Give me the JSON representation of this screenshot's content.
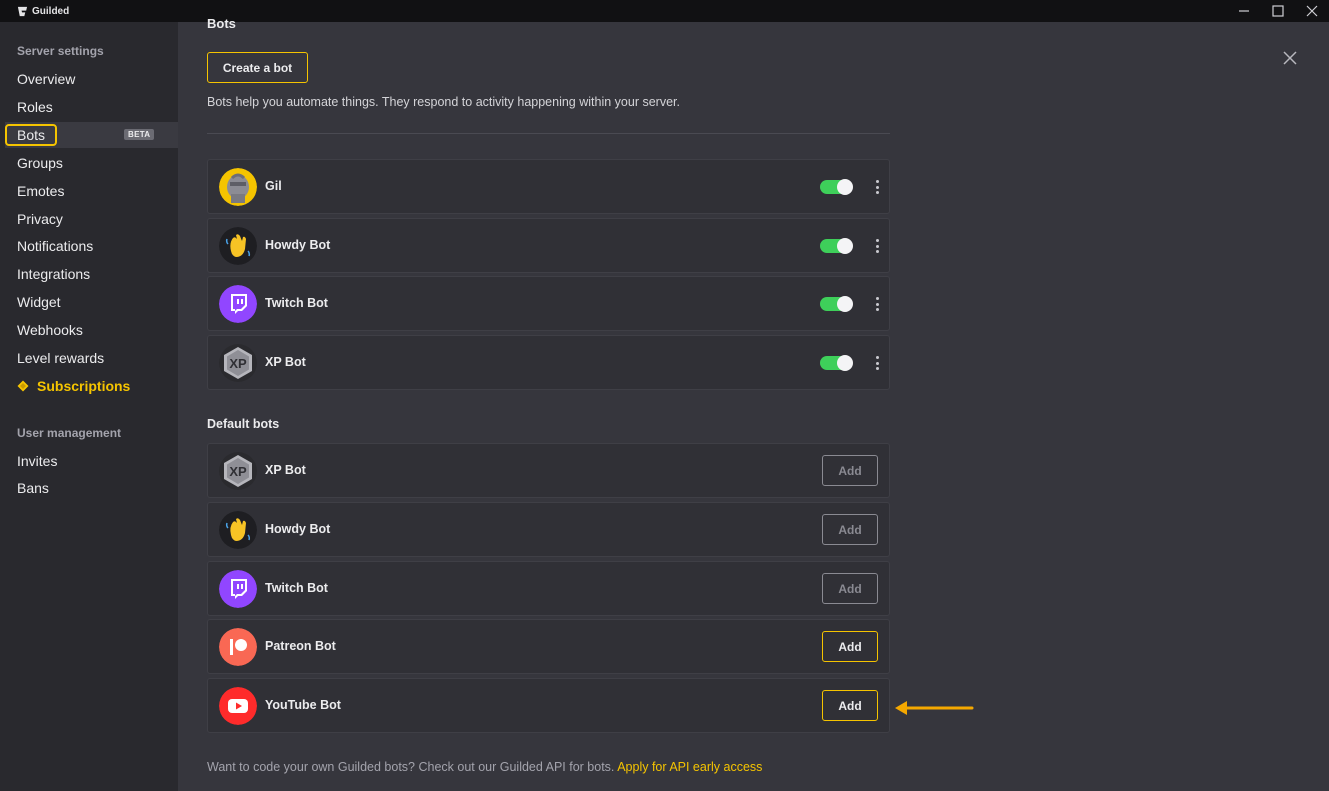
{
  "window": {
    "app_name": "Guilded",
    "icons": {
      "logo": "guilded-logo-icon",
      "minimize": "minimize-icon",
      "maximize": "maximize-icon",
      "close": "close-icon"
    }
  },
  "sidebar": {
    "server_settings_title": "Server settings",
    "items": [
      {
        "label": "Overview"
      },
      {
        "label": "Roles"
      },
      {
        "label": "Bots",
        "badge": "BETA",
        "active": true
      },
      {
        "label": "Groups"
      },
      {
        "label": "Emotes"
      },
      {
        "label": "Privacy"
      },
      {
        "label": "Notifications"
      },
      {
        "label": "Integrations"
      },
      {
        "label": "Widget"
      },
      {
        "label": "Webhooks"
      },
      {
        "label": "Level rewards"
      },
      {
        "label": "Subscriptions",
        "highlight_color": "#f5c400"
      }
    ],
    "user_management_title": "User management",
    "user_items": [
      {
        "label": "Invites"
      },
      {
        "label": "Bans"
      }
    ]
  },
  "main": {
    "title": "Bots",
    "create_button": "Create a bot",
    "intro": "Bots help you automate things. They respond to activity happening within your server.",
    "installed_bots": [
      {
        "name": "Gil",
        "icon": "gil-knight-avatar-icon",
        "enabled": true
      },
      {
        "name": "Howdy Bot",
        "icon": "waving-hand-icon",
        "enabled": true
      },
      {
        "name": "Twitch Bot",
        "icon": "twitch-icon",
        "enabled": true
      },
      {
        "name": "XP Bot",
        "icon": "xp-badge-icon",
        "enabled": true
      }
    ],
    "default_bots_title": "Default bots",
    "default_bots": [
      {
        "name": "XP Bot",
        "icon": "xp-badge-icon",
        "add_label": "Add",
        "add_enabled": false
      },
      {
        "name": "Howdy Bot",
        "icon": "waving-hand-icon",
        "add_label": "Add",
        "add_enabled": false
      },
      {
        "name": "Twitch Bot",
        "icon": "twitch-icon",
        "add_label": "Add",
        "add_enabled": false
      },
      {
        "name": "Patreon Bot",
        "icon": "patreon-icon",
        "add_label": "Add",
        "add_enabled": true
      },
      {
        "name": "YouTube Bot",
        "icon": "youtube-icon",
        "add_label": "Add",
        "add_enabled": true
      }
    ],
    "footer_text": "Want to code your own Guilded bots? Check out our Guilded API for bots.",
    "footer_link": "Apply for API early access"
  },
  "colors": {
    "accent": "#f5c400",
    "toggle_on": "#3ecf5a",
    "annotation_arrow": "#f5a800"
  }
}
